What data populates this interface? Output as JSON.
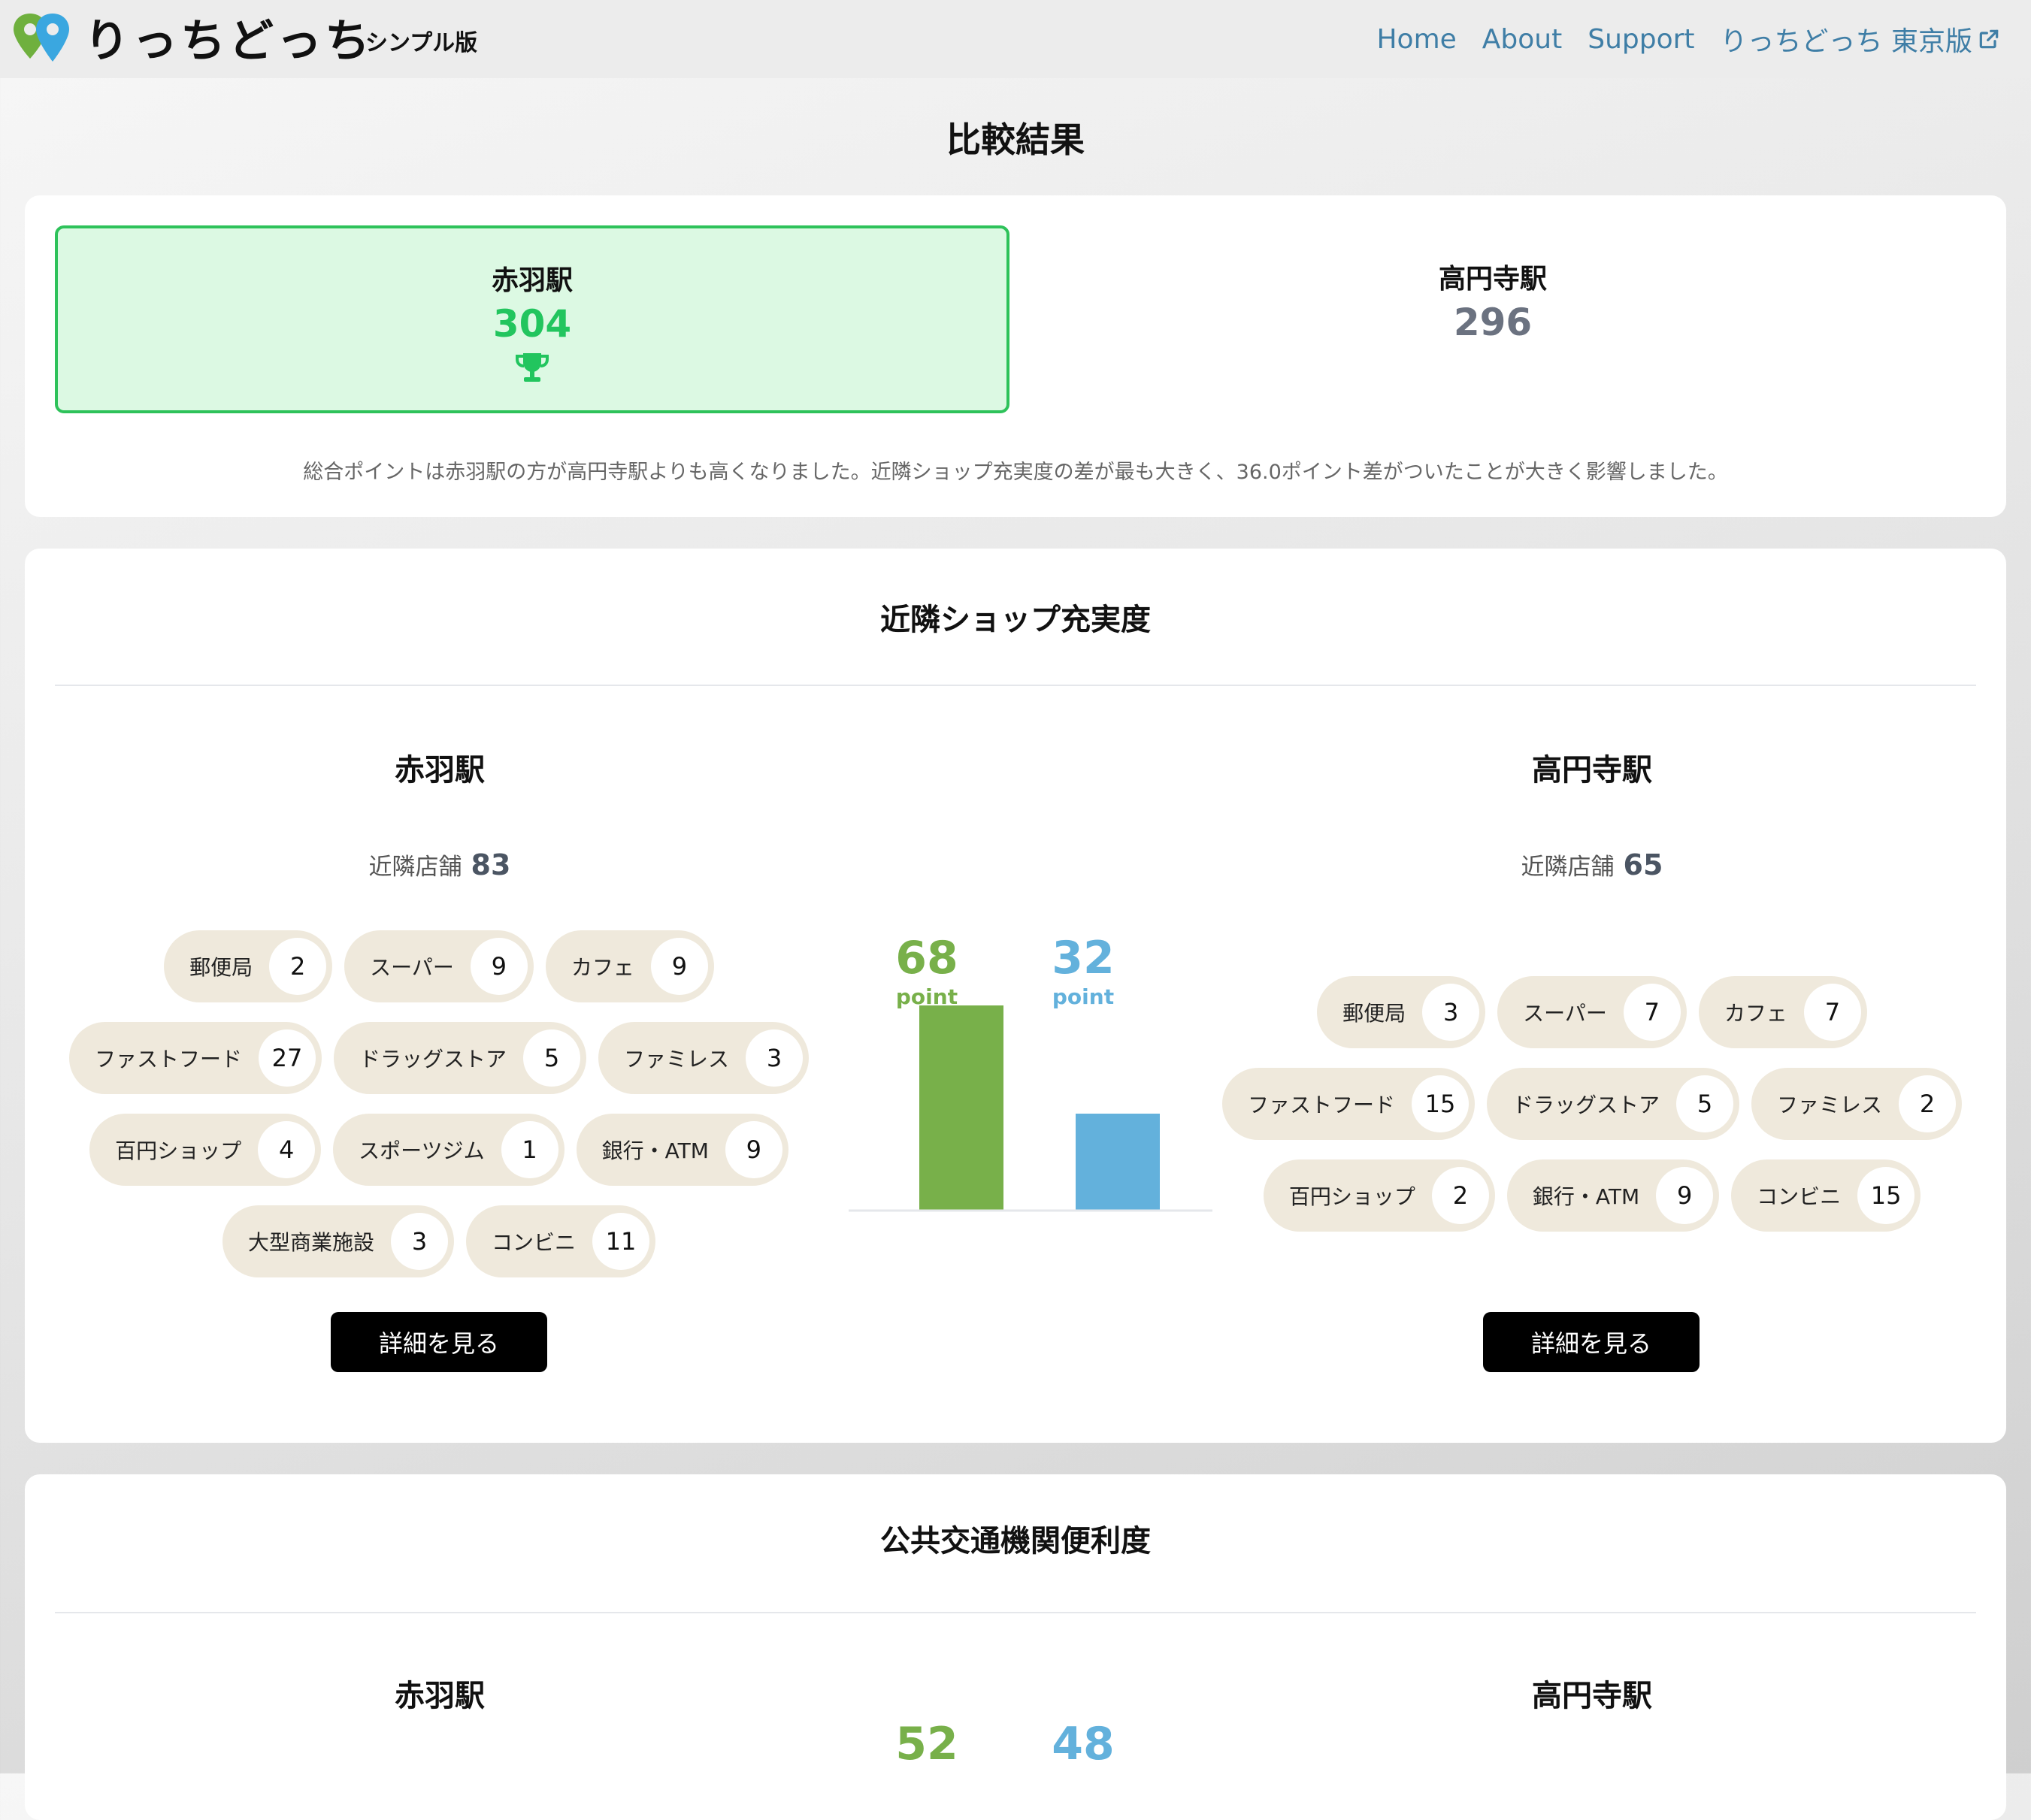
{
  "header": {
    "logo_text": "りっちどっち",
    "logo_sub": "シンプル版",
    "nav": [
      "Home",
      "About",
      "Support",
      "りっちどっち 東京版"
    ]
  },
  "page_title": "比較結果",
  "overall": {
    "winner": {
      "name": "赤羽駅",
      "score": "304"
    },
    "loser": {
      "name": "高円寺駅",
      "score": "296"
    },
    "summary": "総合ポイントは赤羽駅の方が高円寺駅よりも高くなりました。近隣ショップ充実度の差が最も大きく、36.0ポイント差がついたことが大きく影響しました。"
  },
  "shops": {
    "title": "近隣ショップ充実度",
    "left": {
      "name": "赤羽駅",
      "count_label": "近隣店舗",
      "count": "83",
      "rows": [
        [
          {
            "label": "郵便局",
            "n": "2"
          },
          {
            "label": "スーパー",
            "n": "9"
          },
          {
            "label": "カフェ",
            "n": "9"
          }
        ],
        [
          {
            "label": "ファストフード",
            "n": "27"
          },
          {
            "label": "ドラッグストア",
            "n": "5"
          },
          {
            "label": "ファミレス",
            "n": "3"
          }
        ],
        [
          {
            "label": "百円ショップ",
            "n": "4"
          },
          {
            "label": "スポーツジム",
            "n": "1"
          },
          {
            "label": "銀行・ATM",
            "n": "9"
          }
        ],
        [
          {
            "label": "大型商業施設",
            "n": "3"
          },
          {
            "label": "コンビニ",
            "n": "11"
          }
        ]
      ],
      "button": "詳細を見る"
    },
    "right": {
      "name": "高円寺駅",
      "count_label": "近隣店舗",
      "count": "65",
      "rows": [
        [
          {
            "label": "郵便局",
            "n": "3"
          },
          {
            "label": "スーパー",
            "n": "7"
          },
          {
            "label": "カフェ",
            "n": "7"
          }
        ],
        [
          {
            "label": "ファストフード",
            "n": "15"
          },
          {
            "label": "ドラッグストア",
            "n": "5"
          },
          {
            "label": "ファミレス",
            "n": "2"
          }
        ],
        [
          {
            "label": "百円ショップ",
            "n": "2"
          },
          {
            "label": "銀行・ATM",
            "n": "9"
          },
          {
            "label": "コンビニ",
            "n": "15"
          }
        ]
      ],
      "button": "詳細を見る"
    },
    "points": {
      "left": "68",
      "right": "32",
      "unit": "point"
    }
  },
  "transport": {
    "title": "公共交通機関便利度",
    "left_name": "赤羽駅",
    "right_name": "高円寺駅",
    "points": {
      "left": "52",
      "right": "48"
    }
  },
  "colors": {
    "left": "#78b04a",
    "right": "#63b1dc",
    "winner_green": "#22c55e",
    "chip_bg": "#efe9dc",
    "link": "#3f7ea6"
  },
  "chart_data": {
    "type": "bar",
    "categories": [
      "赤羽駅",
      "高円寺駅"
    ],
    "values": [
      68,
      32
    ],
    "title": "",
    "xlabel": "",
    "ylabel": "",
    "ylim": [
      0,
      100
    ]
  }
}
